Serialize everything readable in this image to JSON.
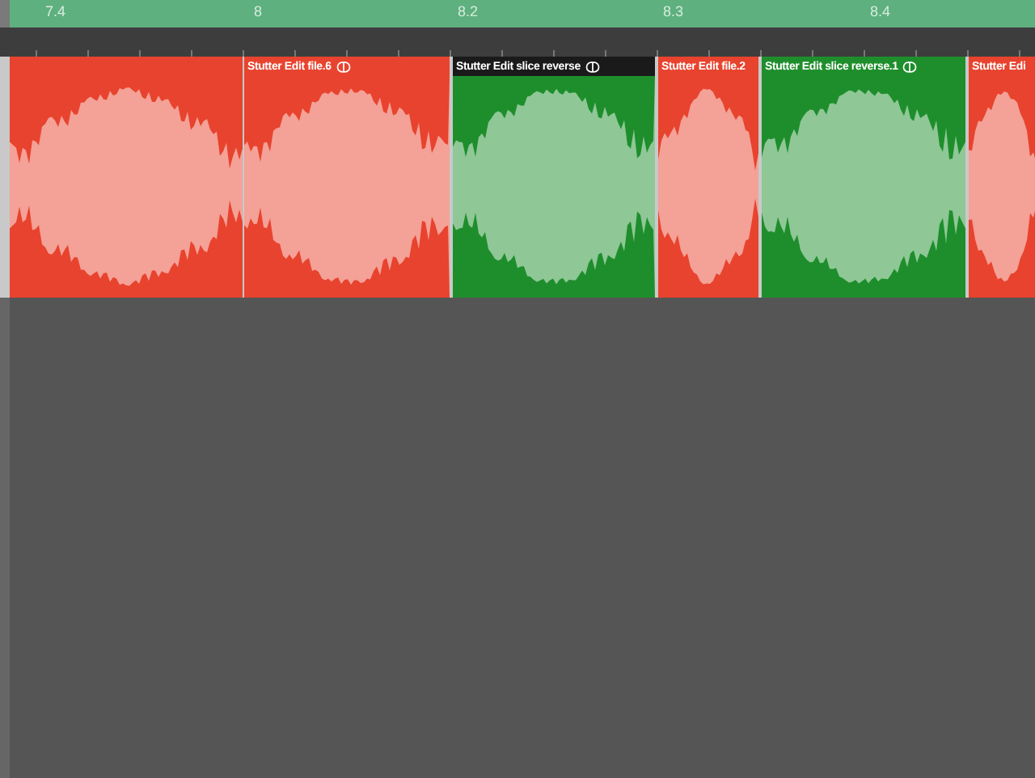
{
  "ruler": {
    "marks": [
      "7.4",
      "8",
      "8.2",
      "8.3",
      "8.4"
    ]
  },
  "regions": [
    {
      "color": "#e8432e",
      "selected": false
    },
    {
      "title": "Stutter Edit file.6",
      "color": "#e8432e",
      "selected": false
    },
    {
      "title": "Stutter Edit slice reverse",
      "color": "#1e8e2c",
      "selected": true
    },
    {
      "title": "Stutter Edit file.2",
      "color": "#e8432e",
      "selected": false
    },
    {
      "title": "Stutter Edit slice reverse.1",
      "color": "#1e8e2c",
      "selected": false
    },
    {
      "title": "Stutter Edi",
      "color": "#e8432e",
      "selected": false
    }
  ]
}
